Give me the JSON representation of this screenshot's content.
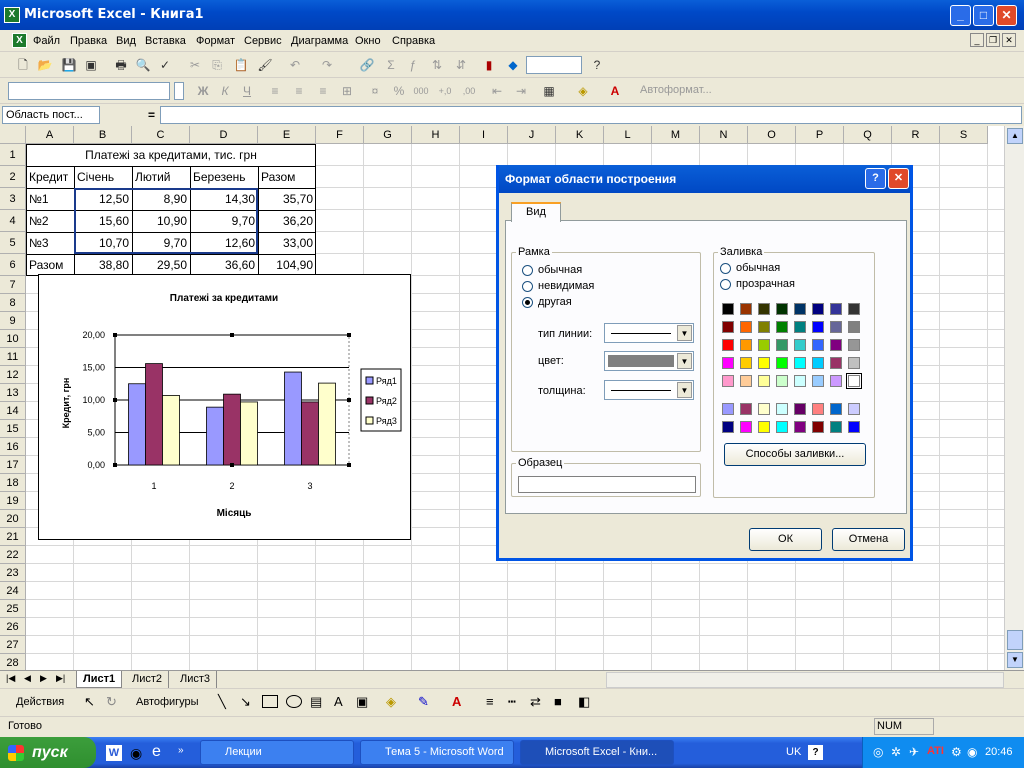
{
  "window": {
    "title": "Microsoft Excel - Книга1"
  },
  "menu": [
    "Файл",
    "Правка",
    "Вид",
    "Вставка",
    "Формат",
    "Сервис",
    "Диаграмма",
    "Окно",
    "Справка"
  ],
  "toolbar": {
    "autoformat_label": "Автоформат..."
  },
  "namebox": "Область пост...",
  "formula_eq": "=",
  "columns": [
    "A",
    "B",
    "C",
    "D",
    "E",
    "F",
    "G",
    "H",
    "I",
    "J",
    "K",
    "L",
    "M",
    "N",
    "O",
    "P",
    "Q",
    "R",
    "S"
  ],
  "rows": [
    "1",
    "2",
    "3",
    "4",
    "5",
    "6",
    "7",
    "8",
    "9",
    "10",
    "11",
    "12",
    "13",
    "14",
    "15",
    "16",
    "17",
    "18",
    "19",
    "20",
    "21",
    "22",
    "23",
    "24",
    "25",
    "26",
    "27",
    "28"
  ],
  "table": {
    "title": "Платежі за кредитами, тис. грн",
    "header": [
      "Кредит",
      "Січень",
      "Лютий",
      "Березень",
      "Разом"
    ],
    "rows": [
      [
        "№1",
        "12,50",
        "8,90",
        "14,30",
        "35,70"
      ],
      [
        "№2",
        "15,60",
        "10,90",
        "9,70",
        "36,20"
      ],
      [
        "№3",
        "10,70",
        "9,70",
        "12,60",
        "33,00"
      ],
      [
        "Разом",
        "38,80",
        "29,50",
        "36,60",
        "104,90"
      ]
    ]
  },
  "chart_data": {
    "type": "bar",
    "title": "Платежі за кредитами",
    "xlabel": "Місяць",
    "ylabel": "Кредит, грн",
    "categories": [
      "1",
      "2",
      "3"
    ],
    "ylim": [
      0,
      20
    ],
    "yticks": [
      "0,00",
      "5,00",
      "10,00",
      "15,00",
      "20,00"
    ],
    "legend_position": "right",
    "series": [
      {
        "name": "Ряд1",
        "values": [
          12.5,
          8.9,
          14.3
        ],
        "color": "#9999ff"
      },
      {
        "name": "Ряд2",
        "values": [
          15.6,
          10.9,
          9.7
        ],
        "color": "#993366"
      },
      {
        "name": "Ряд3",
        "values": [
          10.7,
          9.7,
          12.6
        ],
        "color": "#ffffcc"
      }
    ]
  },
  "sheets": [
    "Лист1",
    "Лист2",
    "Лист3"
  ],
  "drawbar": {
    "actions": "Действия",
    "autoshapes": "Автофигуры"
  },
  "status": {
    "ready": "Готово",
    "num": "NUM"
  },
  "dialog": {
    "title": "Формат области построения",
    "tab": "Вид",
    "border_group": "Рамка",
    "border_options": [
      "обычная",
      "невидимая",
      "другая"
    ],
    "line_type_label": "тип линии:",
    "color_label": "цвет:",
    "thickness_label": "толщина:",
    "sample_group": "Образец",
    "fill_group": "Заливка",
    "fill_options": [
      "обычная",
      "прозрачная"
    ],
    "fill_effects_button": "Способы заливки...",
    "ok_button": "ОК",
    "cancel_button": "Отмена",
    "palette": [
      [
        "#000000",
        "#993300",
        "#333300",
        "#003300",
        "#003366",
        "#000080",
        "#333399",
        "#333333"
      ],
      [
        "#800000",
        "#ff6600",
        "#808000",
        "#008000",
        "#008080",
        "#0000ff",
        "#666699",
        "#808080"
      ],
      [
        "#ff0000",
        "#ff9900",
        "#99cc00",
        "#339966",
        "#33cccc",
        "#3366ff",
        "#800080",
        "#969696"
      ],
      [
        "#ff00ff",
        "#ffcc00",
        "#ffff00",
        "#00ff00",
        "#00ffff",
        "#00ccff",
        "#993366",
        "#c0c0c0"
      ],
      [
        "#ff99cc",
        "#ffcc99",
        "#ffff99",
        "#ccffcc",
        "#ccffff",
        "#99ccff",
        "#cc99ff",
        "#ffffff"
      ]
    ],
    "palette2": [
      [
        "#9999ff",
        "#993366",
        "#ffffcc",
        "#ccffff",
        "#660066",
        "#ff8080",
        "#0066cc",
        "#ccccff"
      ],
      [
        "#000080",
        "#ff00ff",
        "#ffff00",
        "#00ffff",
        "#800080",
        "#800000",
        "#008080",
        "#0000ff"
      ]
    ]
  },
  "taskbar": {
    "start": "пуск",
    "tasks": [
      "Лекции",
      "Тема 5 - Microsoft Word",
      "Microsoft Excel - Кни..."
    ],
    "lang": "UK",
    "clock": "20:46"
  }
}
